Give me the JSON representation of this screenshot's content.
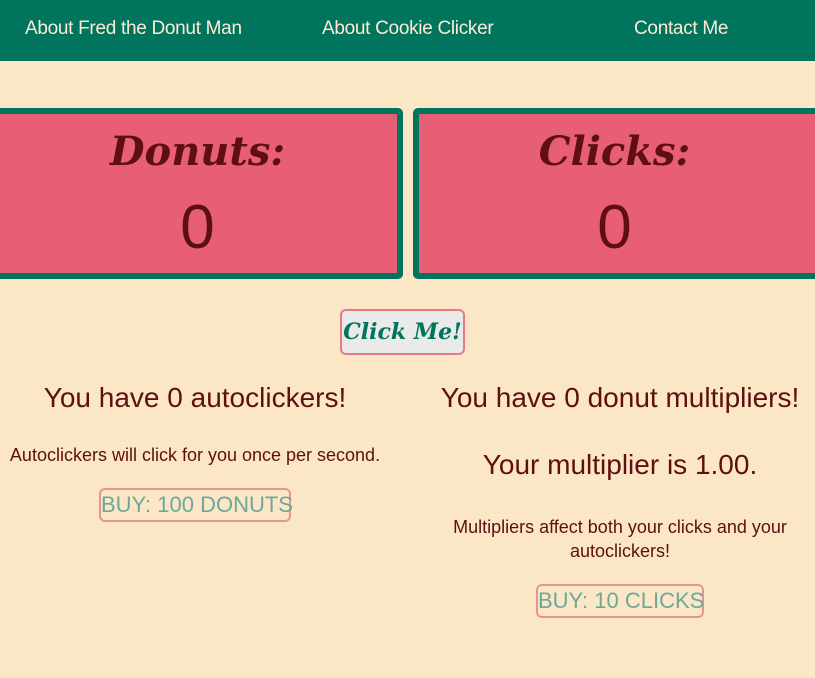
{
  "nav": {
    "items": [
      {
        "label": "About Fred the Donut Man"
      },
      {
        "label": "About Cookie Clicker"
      },
      {
        "label": "Contact Me"
      }
    ]
  },
  "donuts_panel": {
    "title": "Donuts:",
    "value": "0"
  },
  "clicks_panel": {
    "title": "Clicks:",
    "value": "0"
  },
  "click_button": {
    "label": "Click Me!"
  },
  "autoclickers": {
    "heading": "You have 0 autoclickers!",
    "description": "Autoclickers will click for you once per second.",
    "buy_label": "BUY: 100 DONUTS"
  },
  "multipliers": {
    "heading": "You have 0 donut multipliers!",
    "multiplier_text": "Your multiplier is 1.00.",
    "description": "Multipliers affect both your clicks and your autoclickers!",
    "buy_label": "BUY: 10 CLICKS"
  },
  "colors": {
    "background": "#fbe6c6",
    "nav": "#00745c",
    "panel": "#e85e75",
    "text": "#5e0f0f",
    "button_text": "#6ea89a"
  }
}
